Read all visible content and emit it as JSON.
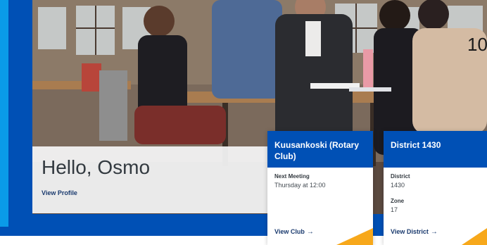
{
  "greeting": {
    "title": "Hello, Osmo",
    "link": "View Profile"
  },
  "overlay_number": "10",
  "cards": [
    {
      "title": "Kuusankoski (Rotary Club)",
      "fields": [
        {
          "label": "Next Meeting",
          "value": "Thursday at 12:00"
        }
      ],
      "link": "View Club"
    },
    {
      "title": "District 1430",
      "fields": [
        {
          "label": "District",
          "value": "1430"
        },
        {
          "label": "Zone",
          "value": "17"
        }
      ],
      "link": "View District"
    }
  ],
  "icons": {
    "arrow": "→"
  },
  "colors": {
    "brand_blue": "#0050b5",
    "accent_light_blue": "#0a9be8",
    "accent_gold": "#f7a81b"
  }
}
